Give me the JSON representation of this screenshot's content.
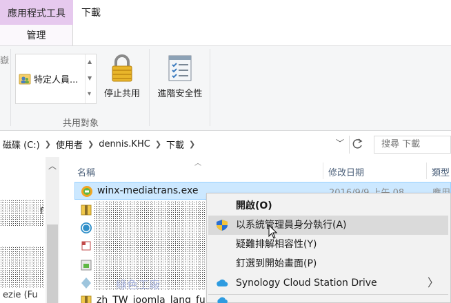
{
  "ribbon": {
    "context_tab_title": "應用程式工具",
    "manage_tab": "管理",
    "download_tab": "下載",
    "left_stub": "嶽",
    "share_target_item": "特定人員...",
    "stop_sharing": "停止共用",
    "advanced_security": "進階安全性",
    "share_group_label": "共用對象"
  },
  "address": {
    "crumbs": [
      "磁碟 (C:)",
      "使用者",
      "dennis.KHC",
      "下載"
    ],
    "search_placeholder": "搜尋 下載"
  },
  "columns": {
    "name": "名稱",
    "date_modified": "修改日期",
    "type": "類型"
  },
  "files": [
    {
      "name": "winx-mediatrans.exe",
      "date": "2016/9/9 上午 08...",
      "type": "應用"
    },
    {
      "name": "",
      "date": "",
      "type": ""
    },
    {
      "name": "",
      "date": "",
      "type": ""
    },
    {
      "name": "",
      "date": "",
      "type": ""
    },
    {
      "name": "",
      "date": "",
      "type": ""
    },
    {
      "name": "",
      "date": "",
      "type": ""
    },
    {
      "name": "zh_TW_joomla_lang_fu...",
      "date": "",
      "type": ""
    }
  ],
  "nav_fragments": {
    "frag1": "f",
    "frag2": "ezie (Fu"
  },
  "watermark": "綠色工廠",
  "context_menu": {
    "items": [
      {
        "label": "開啟(O)",
        "bold": true
      },
      {
        "label": "以系統管理員身分執行(A)",
        "icon": "uac-shield-icon"
      },
      {
        "label": "疑難排解相容性(Y)"
      },
      {
        "label": "釘選到開始畫面(P)"
      },
      {
        "label": "Synology Cloud Station Drive",
        "icon": "synology-cloud-icon",
        "submenu": true
      }
    ]
  },
  "colors": {
    "context_tab": "#e6c9ee",
    "selection": "#cce8ff",
    "menu_hover": "#dadada"
  }
}
